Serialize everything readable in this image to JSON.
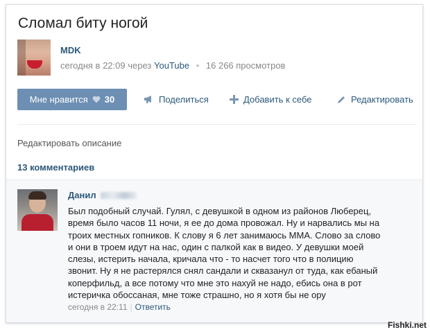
{
  "post": {
    "title": "Сломал биту ногой",
    "author": "MDK",
    "time": "сегодня в 22:09 через",
    "source": "YouTube",
    "views": "16 266 просмотров"
  },
  "actions": {
    "like_label": "Мне нравится",
    "like_count": "30",
    "share": "Поделиться",
    "add": "Добавить к себе",
    "edit": "Редактировать"
  },
  "edit_description": "Редактировать описание",
  "comments_count": "13 комментариев",
  "comment": {
    "author": "Данил",
    "lines": [
      "Был подобный случай. Гулял, с девушкой в одном из районов Люберец,",
      "время было часов 11 ночи, я ее до дома провожал. Ну и нарвались мы на",
      "троих местных гопников. К слову я 6 лет занимаюсь ММА. Слово за слово",
      "и они в троем идут на нас, один с палкой как в видео. У девушки моей",
      "слезы, истерить начала, кричала что - то насчет того что в полицию",
      "звонит. Ну я не растерялся снял сандали и сквазанул от туда, как ебаный",
      "коперфильд, а все потому что мне это нахуй не надо, ебись она в рот",
      "истеричка обоссаная, мне тоже страшно, но я хотя бы не ору"
    ],
    "time": "сегодня в 22:11",
    "reply": "Ответить"
  },
  "watermark": "Fishki.net",
  "colors": {
    "link": "#2b587a",
    "like_button": "#6d8fb3",
    "meta_text": "#888888"
  },
  "icons": [
    "heart-icon",
    "megaphone-icon",
    "plus-icon",
    "pencil-icon"
  ]
}
